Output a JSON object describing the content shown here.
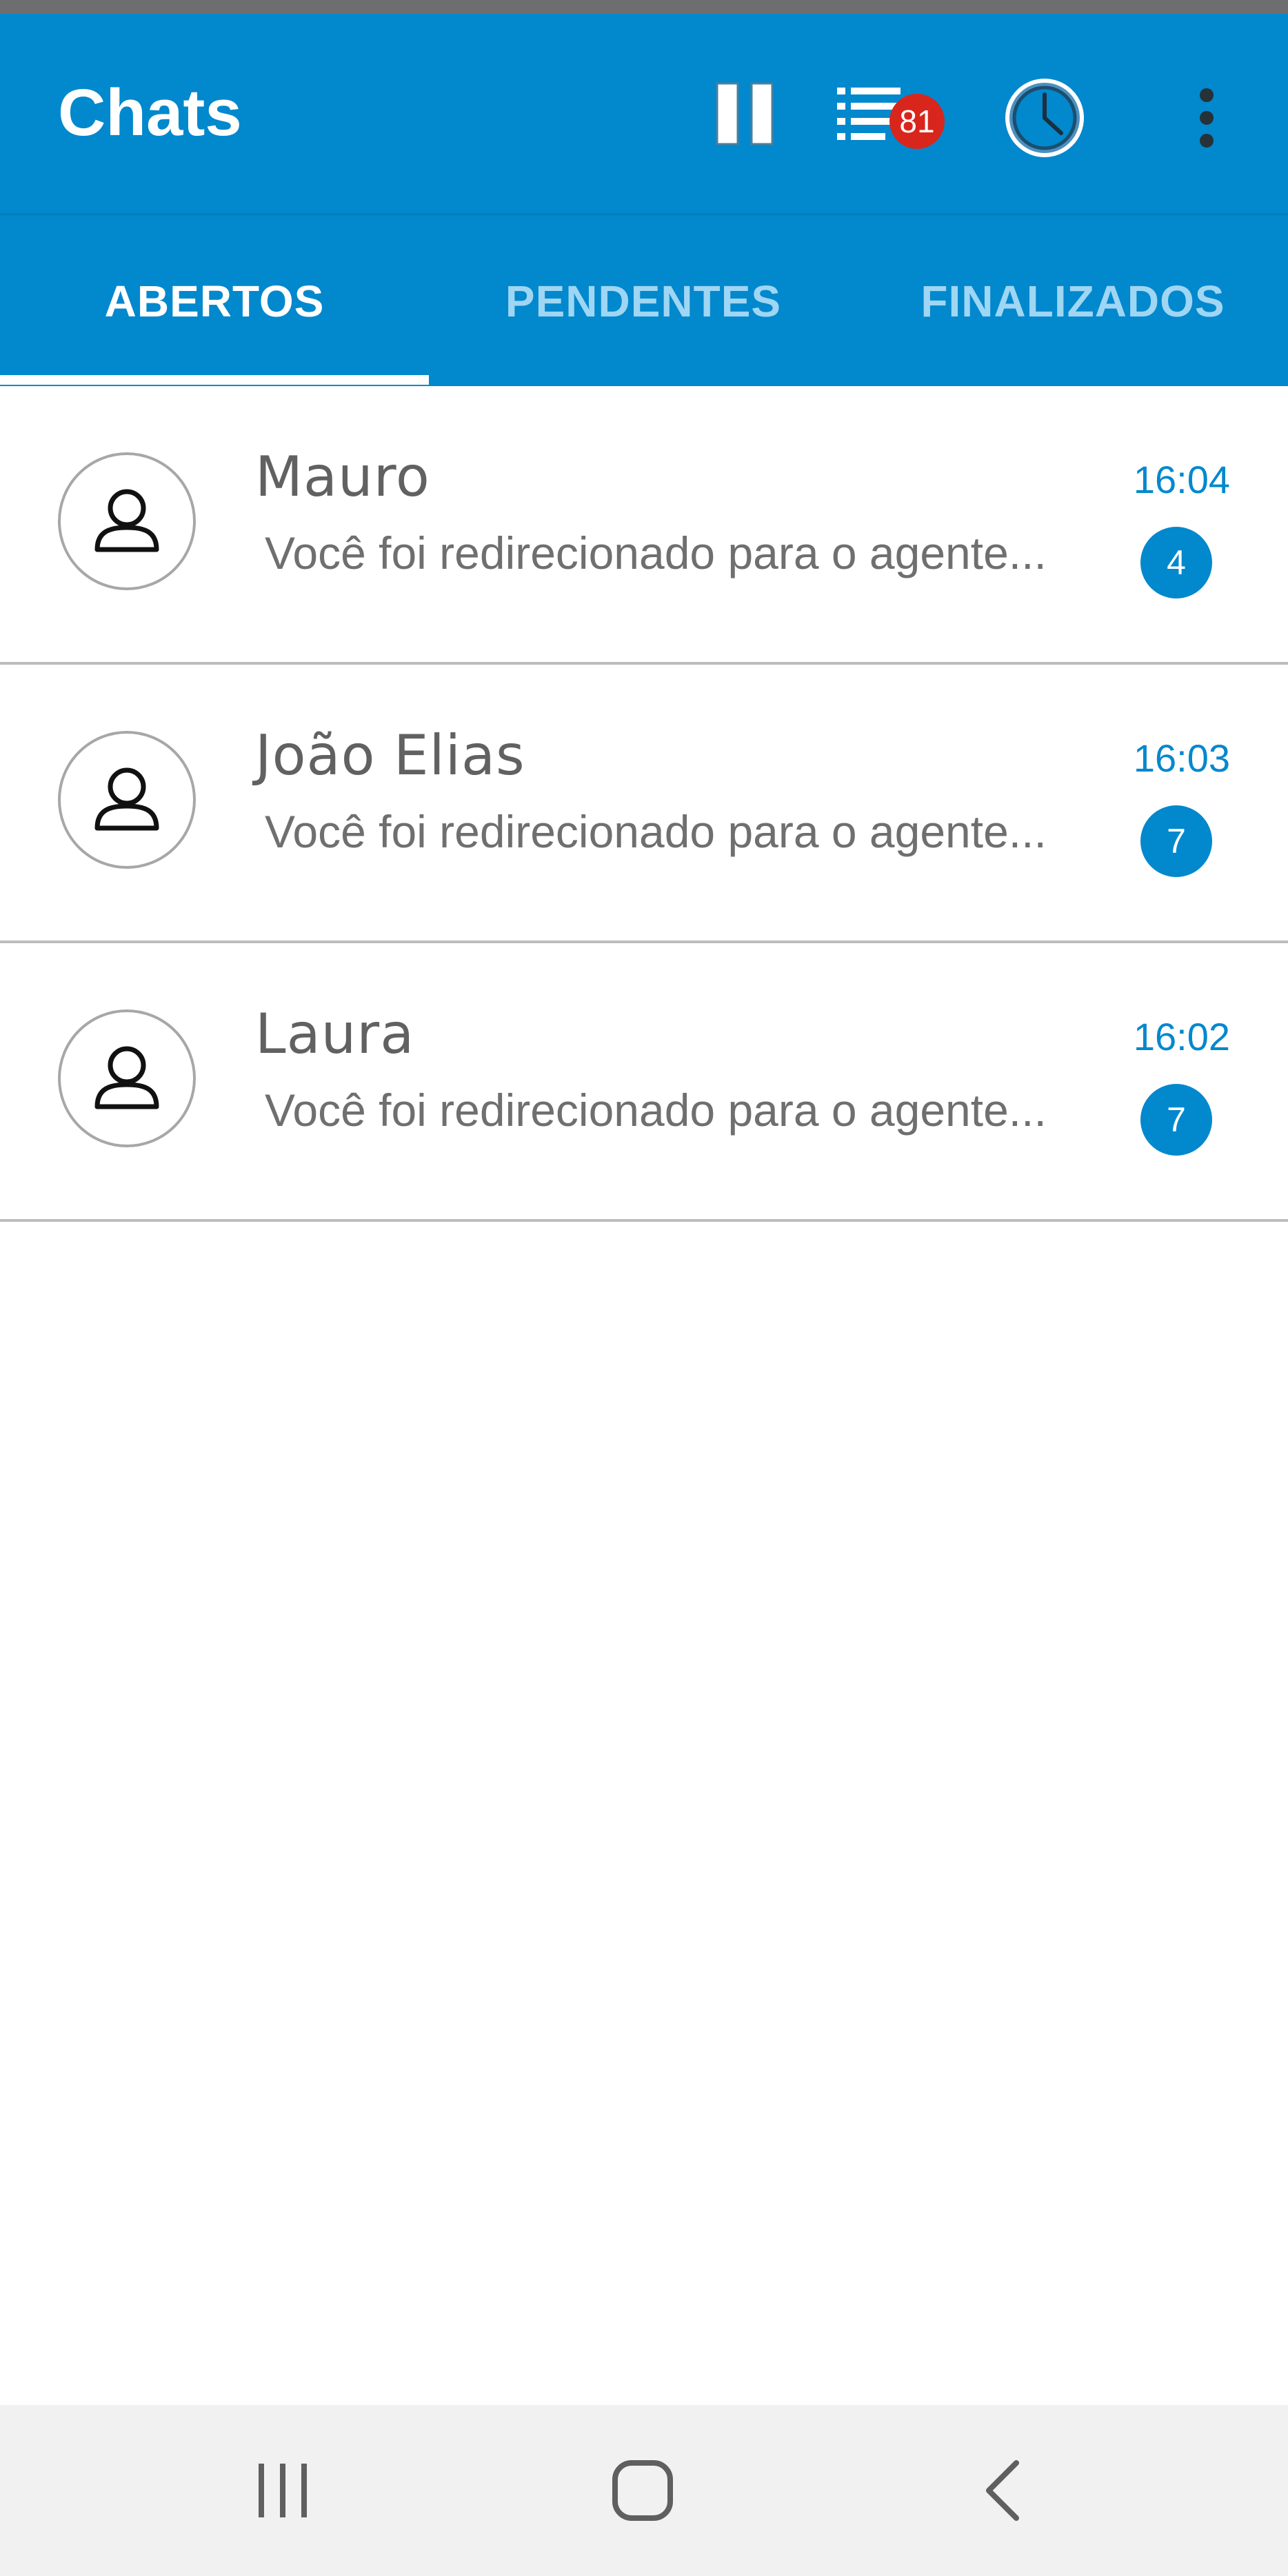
{
  "app_bar": {
    "title": "Chats",
    "queue_count": "81"
  },
  "icons": {
    "pause": "pause-icon",
    "queue": "list-icon",
    "clock": "clock-icon",
    "menu": "more-vert-icon",
    "avatar": "person-icon",
    "recent_apps": "recent-apps-icon",
    "home": "home-icon",
    "back": "back-icon"
  },
  "tabs": [
    {
      "label": "ABERTOS",
      "active": true
    },
    {
      "label": "PENDENTES",
      "active": false
    },
    {
      "label": "FINALIZADOS",
      "active": false
    }
  ],
  "chats": [
    {
      "name": "Mauro",
      "time": "16:04",
      "preview": "Você foi redirecionado para o agente...",
      "unread": "4"
    },
    {
      "name": "João Elias",
      "time": "16:03",
      "preview": "Você foi redirecionado para o agente...",
      "unread": "7"
    },
    {
      "name": "Laura",
      "time": "16:02",
      "preview": "Você foi redirecionado para o agente...",
      "unread": "7"
    }
  ],
  "colors": {
    "primary": "#0288cd",
    "badge_red": "#d8261d",
    "tab_inactive": "#9fd6f3",
    "text_gray": "#6f6f6f",
    "nav_bar": "#f1f1f1"
  }
}
